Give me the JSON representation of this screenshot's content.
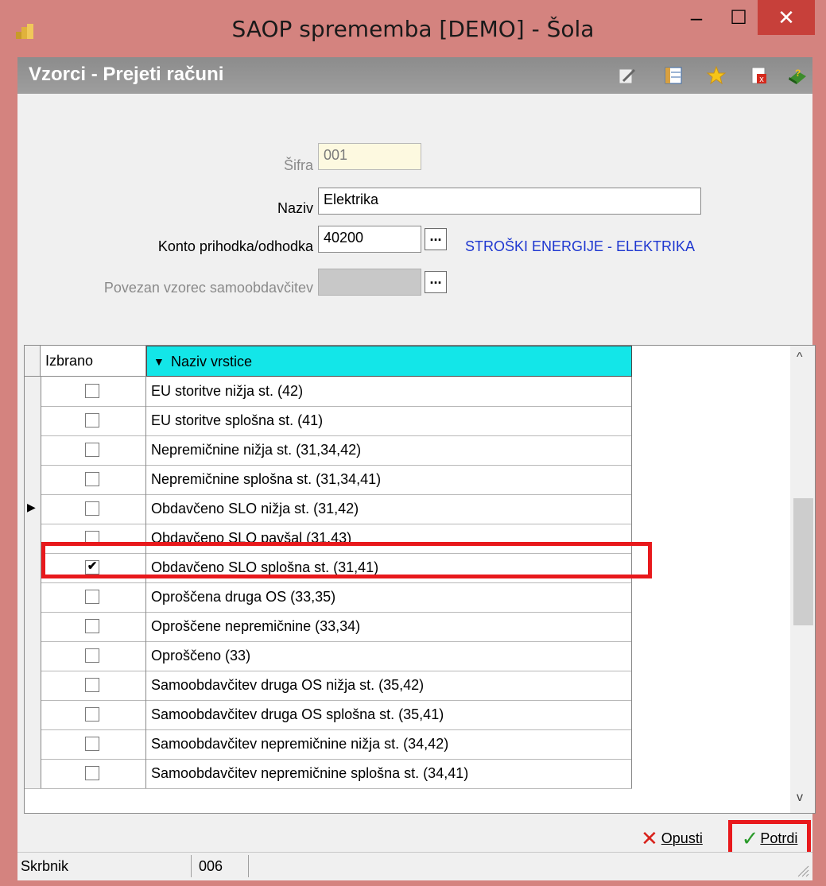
{
  "window": {
    "title": "SAOP sprememba [DEMO] - Šola",
    "minimize": "–",
    "maximize": "☐",
    "close": "✕"
  },
  "header": {
    "title": "Vzorci - Prejeti računi"
  },
  "form": {
    "sifra_label": "Šifra",
    "sifra_value": "001",
    "naziv_label": "Naziv",
    "naziv_value": "Elektrika",
    "konto_label": "Konto prihodka/odhodka",
    "konto_value": "40200",
    "konto_desc": "STROŠKI ENERGIJE - ELEKTRIKA",
    "povezan_label": "Povezan vzorec samoobdavčitev",
    "povezan_value": "",
    "dots": "..."
  },
  "grid": {
    "col_izbrano": "Izbrano",
    "col_naziv": "Naziv vrstice",
    "rows": [
      {
        "label": "EU storitve nižja st. (42)",
        "checked": false
      },
      {
        "label": "EU storitve splošna st. (41)",
        "checked": false
      },
      {
        "label": "Nepremičnine nižja st. (31,34,42)",
        "checked": false
      },
      {
        "label": "Nepremičnine splošna st. (31,34,41)",
        "checked": false
      },
      {
        "label": "Obdavčeno SLO nižja st. (31,42)",
        "checked": false,
        "current": true
      },
      {
        "label": "Obdavčeno SLO pavšal (31,43)",
        "checked": false
      },
      {
        "label": "Obdavčeno SLO splošna st. (31,41)",
        "checked": true
      },
      {
        "label": "Oproščena druga OS (33,35)",
        "checked": false
      },
      {
        "label": "Oproščene nepremičnine (33,34)",
        "checked": false
      },
      {
        "label": "Oproščeno (33)",
        "checked": false
      },
      {
        "label": "Samoobdavčitev druga OS nižja st. (35,42)",
        "checked": false
      },
      {
        "label": "Samoobdavčitev druga OS splošna st. (35,41)",
        "checked": false
      },
      {
        "label": "Samoobdavčitev nepremičnine nižja st. (34,42)",
        "checked": false
      },
      {
        "label": "Samoobdavčitev nepremičnine splošna st. (34,41)",
        "checked": false
      }
    ]
  },
  "buttons": {
    "opusti": "Opusti",
    "potrdi": "Potrdi"
  },
  "status": {
    "user": "Skrbnik",
    "code": "006"
  },
  "colors": {
    "title_bar": "#d4837f",
    "close_button": "#c7403a",
    "grid_header": "#13e6e8",
    "highlight": "#e8191c",
    "link_text": "#1e37d0"
  }
}
